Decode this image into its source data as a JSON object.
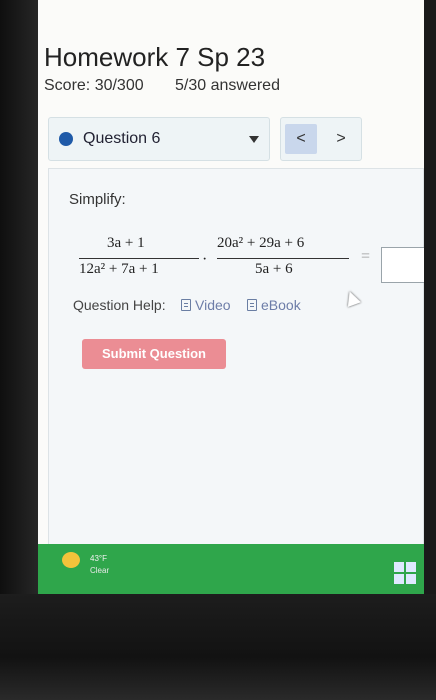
{
  "header": {
    "title": "Homework 7 Sp 23",
    "score": "Score: 30/300",
    "answered": "5/30 answered"
  },
  "question_nav": {
    "selected": "Question 6",
    "prev": "<",
    "next": ">"
  },
  "question": {
    "prompt": "Simplify:",
    "fraction1": {
      "numerator": "3a + 1",
      "denominator": "12a² + 7a + 1"
    },
    "operator": "·",
    "fraction2": {
      "numerator": "20a² + 29a + 6",
      "denominator": "5a + 6"
    },
    "equals": "=",
    "answer_value": ""
  },
  "help": {
    "label": "Question Help:",
    "video": "Video",
    "ebook": "eBook"
  },
  "submit_label": "Submit Question",
  "taskbar": {
    "temperature": "43°F",
    "condition": "Clear"
  },
  "colors": {
    "accent": "#1f5aa8",
    "submit": "#eb8d94",
    "taskbar": "#2fa64b"
  }
}
